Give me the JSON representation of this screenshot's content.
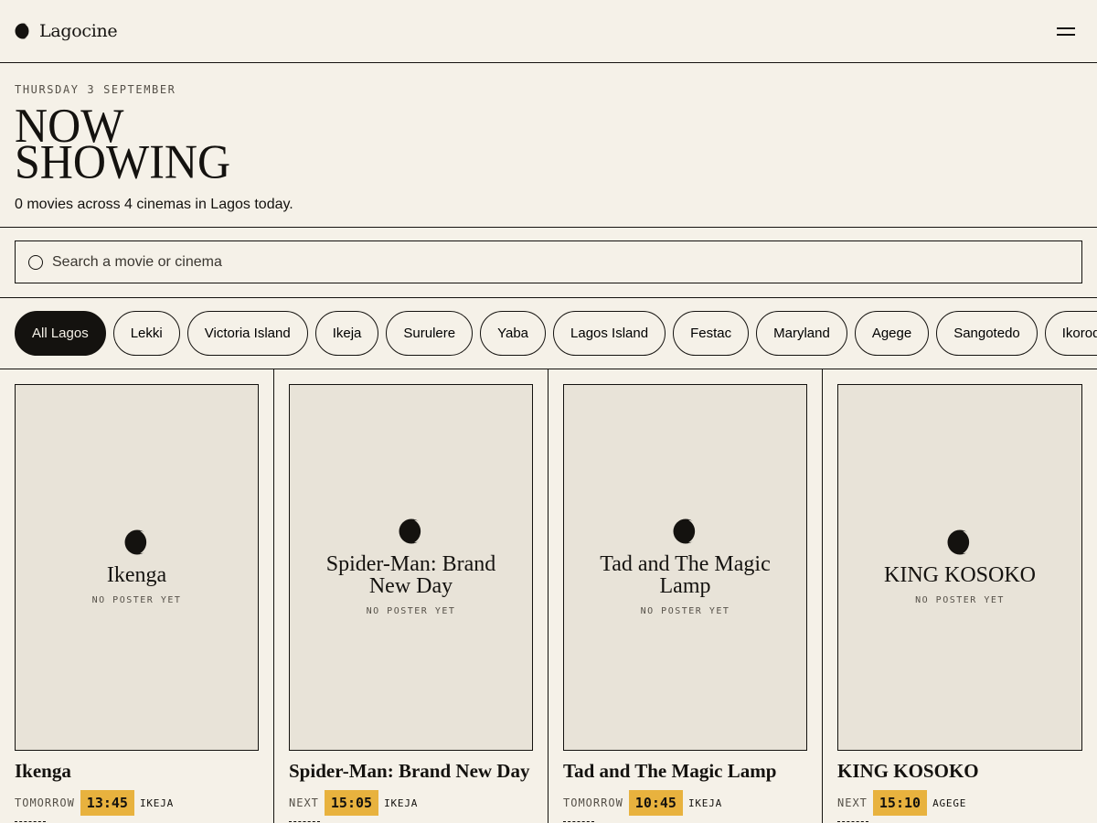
{
  "brand": {
    "name": "Lagocine"
  },
  "hero": {
    "date": "THURSDAY 3 SEPTEMBER",
    "title_line1": "NOW",
    "title_line2": "SHOWING",
    "subtitle": "0 movies across 4 cinemas in Lagos today."
  },
  "search": {
    "placeholder": "Search a movie or cinema"
  },
  "filters": [
    {
      "label": "All Lagos",
      "active": true
    },
    {
      "label": "Lekki"
    },
    {
      "label": "Victoria Island"
    },
    {
      "label": "Ikeja"
    },
    {
      "label": "Surulere"
    },
    {
      "label": "Yaba"
    },
    {
      "label": "Lagos Island"
    },
    {
      "label": "Festac"
    },
    {
      "label": "Maryland"
    },
    {
      "label": "Agege"
    },
    {
      "label": "Sangotedo"
    },
    {
      "label": "Ikorodu Ro"
    }
  ],
  "movies": [
    {
      "poster_title": "Ikenga",
      "no_poster": "NO POSTER YET",
      "title": "Ikenga",
      "when": "TOMORROW",
      "time": "13:45",
      "cinema": "IKEJA"
    },
    {
      "poster_title": "Spider-Man: Brand New Day",
      "no_poster": "NO POSTER YET",
      "title": "Spider-Man: Brand New Day",
      "when": "NEXT",
      "time": "15:05",
      "cinema": "IKEJA"
    },
    {
      "poster_title": "Tad and The Magic Lamp",
      "no_poster": "NO POSTER YET",
      "title": "Tad and The Magic Lamp",
      "when": "TOMORROW",
      "time": "10:45",
      "cinema": "IKEJA"
    },
    {
      "poster_title": "KING KOSOKO",
      "no_poster": "NO POSTER YET",
      "title": "KING KOSOKO",
      "when": "NEXT",
      "time": "15:10",
      "cinema": "AGEGE"
    }
  ],
  "colors": {
    "background": "#f5f1e8",
    "ink": "#14120f",
    "poster_bg": "#e8e3d8",
    "accent": "#e8b23e"
  }
}
